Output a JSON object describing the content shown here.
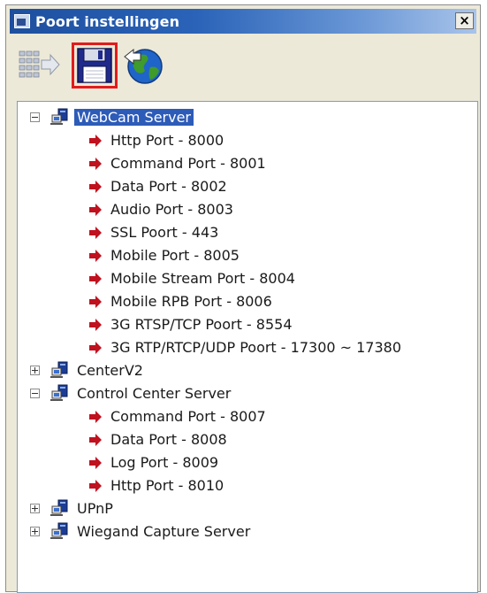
{
  "window": {
    "title": "Poort instellingen",
    "close_glyph": "×"
  },
  "toolbar": [
    {
      "name": "port-config-button",
      "icon": "network-grid-icon"
    },
    {
      "name": "save-button",
      "icon": "floppy-disk-icon",
      "highlighted": true
    },
    {
      "name": "network-globe-button",
      "icon": "globe-icon"
    }
  ],
  "colors": {
    "title_bar": "#2a63b8",
    "selection": "#2d5bb8",
    "arrow": "#c0111f",
    "highlight_border": "#e21b1b"
  },
  "tree": [
    {
      "label": "WebCam Server",
      "expanded": true,
      "selected": true,
      "children": [
        "Http Port - 8000",
        "Command Port - 8001",
        "Data Port - 8002",
        "Audio Port - 8003",
        "SSL Poort - 443",
        "Mobile Port - 8005",
        "Mobile Stream Port - 8004",
        "Mobile RPB Port - 8006",
        "3G RTSP/TCP Poort - 8554",
        "3G RTP/RTCP/UDP Poort - 17300 ~ 17380"
      ]
    },
    {
      "label": "CenterV2",
      "expanded": false,
      "children": []
    },
    {
      "label": "Control Center Server",
      "expanded": true,
      "children": [
        "Command Port - 8007",
        "Data Port - 8008",
        "Log Port - 8009",
        "Http Port - 8010"
      ]
    },
    {
      "label": "UPnP",
      "expanded": false,
      "children": []
    },
    {
      "label": "Wiegand Capture Server",
      "expanded": false,
      "children": []
    }
  ]
}
